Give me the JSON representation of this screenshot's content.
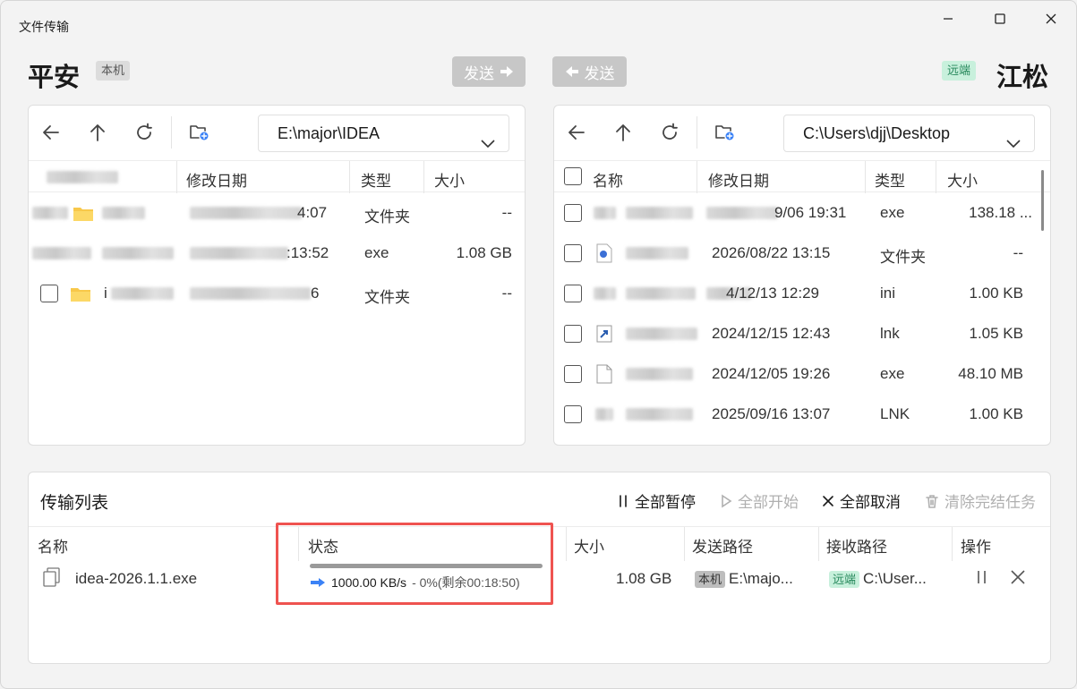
{
  "window": {
    "title": "文件传输"
  },
  "local": {
    "host_name": "平安",
    "tag": "本机",
    "path": "E:\\major\\IDEA",
    "columns": [
      "修改日期",
      "类型",
      "大小"
    ],
    "rows": [
      {
        "date_fragment": "4:07",
        "type": "文件夹",
        "size": "--",
        "icon": "folder-icon"
      },
      {
        "date_fragment": ":13:52",
        "type": "exe",
        "size": "1.08 GB",
        "icon": "file-icon"
      },
      {
        "name_fragment": "i",
        "date_fragment": "6",
        "type": "文件夹",
        "size": "--",
        "icon": "folder-icon"
      }
    ]
  },
  "remote": {
    "host_name": "江松",
    "tag": "远端",
    "path": "C:\\Users\\djj\\Desktop",
    "columns": [
      "名称",
      "修改日期",
      "类型",
      "大小"
    ],
    "rows": [
      {
        "date": "9/06 19:31",
        "type": "exe",
        "size": "138.18 ...",
        "icon": "file-icon"
      },
      {
        "date": "2026/08/22 13:15",
        "type": "文件夹",
        "size": "--",
        "icon": "app-icon"
      },
      {
        "date": "4/12/13 12:29",
        "type": "ini",
        "size": "1.00 KB",
        "icon": "file-icon"
      },
      {
        "date": "2024/12/15 12:43",
        "type": "lnk",
        "size": "1.05 KB",
        "icon": "shortcut-icon"
      },
      {
        "date": "2024/12/05 19:26",
        "type": "exe",
        "size": "48.10 MB",
        "icon": "file-icon"
      },
      {
        "date": "2025/09/16 13:07",
        "type": "LNK",
        "size": "1.00 KB",
        "icon": "file-icon"
      }
    ]
  },
  "send": {
    "to_remote": "发送",
    "to_local": "发送"
  },
  "transfer": {
    "title": "传输列表",
    "actions": {
      "pause_all": "全部暂停",
      "start_all": "全部开始",
      "cancel_all": "全部取消",
      "clear_done": "清除完结任务"
    },
    "columns": [
      "名称",
      "状态",
      "大小",
      "发送路径",
      "接收路径",
      "操作"
    ],
    "rows": [
      {
        "name": "idea-2026.1.1.exe",
        "speed": "1000.00 KB/s",
        "progress_text": "- 0%(剩余00:18:50)",
        "progress_fraction": 0.0,
        "size": "1.08 GB",
        "send_tag": "本机",
        "send_path": "E:\\majo...",
        "recv_tag": "远端",
        "recv_path": "C:\\User..."
      }
    ]
  },
  "colors": {
    "accent": "#3b82f6",
    "highlight": "#ef5350",
    "remote_tag_bg": "#c8f0dc",
    "local_tag_bg": "#dcdcdc"
  }
}
